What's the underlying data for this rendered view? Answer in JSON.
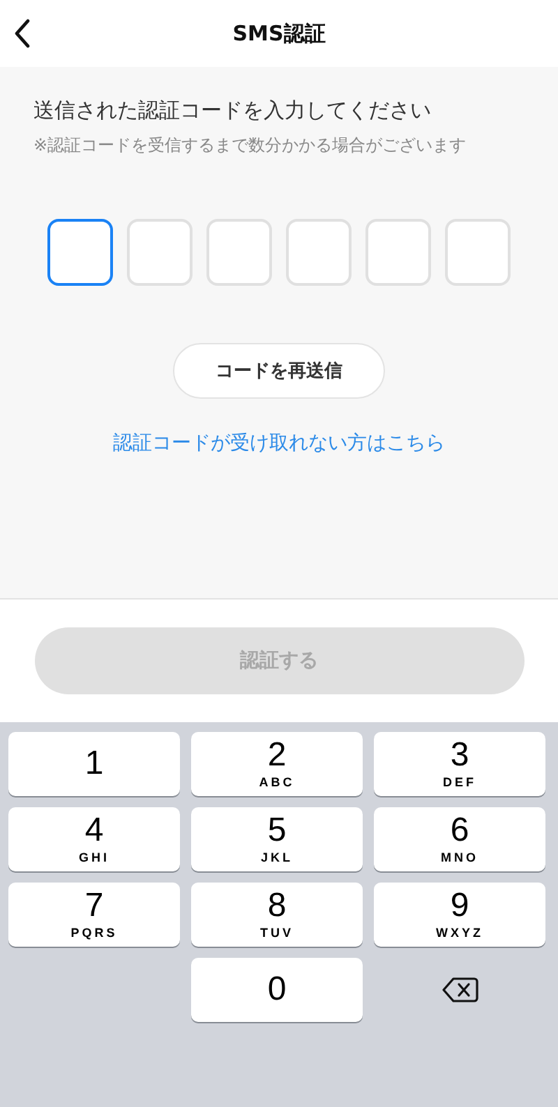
{
  "header": {
    "title": "SMS認証"
  },
  "instruction": "送信された認証コードを入力してください",
  "note": "※認証コードを受信するまで数分かかる場合がございます",
  "code_boxes": [
    {
      "focused": true
    },
    {
      "focused": false
    },
    {
      "focused": false
    },
    {
      "focused": false
    },
    {
      "focused": false
    },
    {
      "focused": false
    }
  ],
  "resend_button": "コードを再送信",
  "help_link": "認証コードが受け取れない方はこちら",
  "submit_button": {
    "label": "認証する",
    "disabled": true
  },
  "keypad": {
    "rows": [
      [
        {
          "kind": "digit",
          "digit": "1"
        },
        {
          "kind": "digit",
          "digit": "2",
          "letters": "ABC"
        },
        {
          "kind": "digit",
          "digit": "3",
          "letters": "DEF"
        }
      ],
      [
        {
          "kind": "digit",
          "digit": "4",
          "letters": "GHI"
        },
        {
          "kind": "digit",
          "digit": "5",
          "letters": "JKL"
        },
        {
          "kind": "digit",
          "digit": "6",
          "letters": "MNO"
        }
      ],
      [
        {
          "kind": "digit",
          "digit": "7",
          "letters": "PQRS"
        },
        {
          "kind": "digit",
          "digit": "8",
          "letters": "TUV"
        },
        {
          "kind": "digit",
          "digit": "9",
          "letters": "WXYZ"
        }
      ],
      [
        "",
        {
          "kind": "digit",
          "digit": "0"
        },
        {
          "kind": "delete"
        }
      ]
    ]
  }
}
